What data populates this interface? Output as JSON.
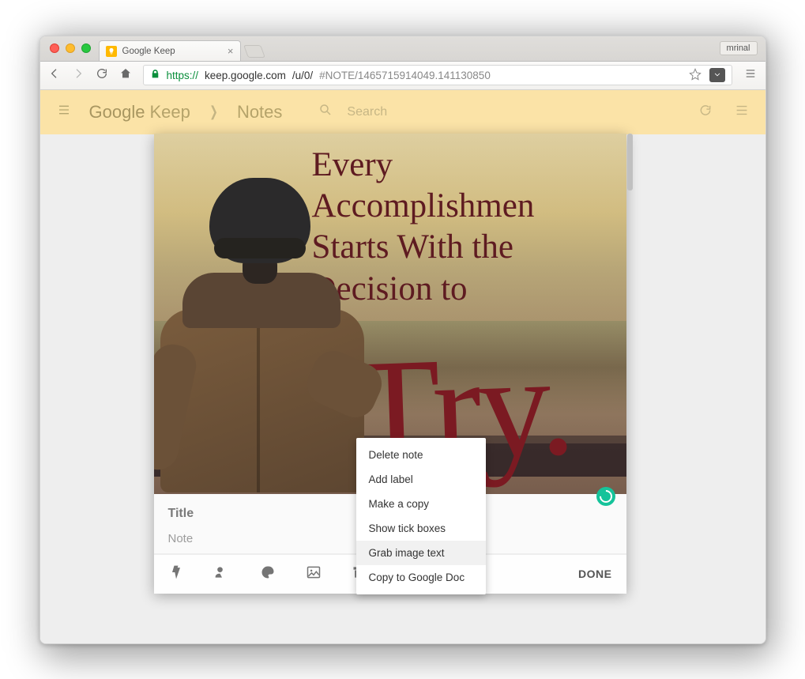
{
  "browser": {
    "tab_title": "Google Keep",
    "profile_name": "mrinal",
    "url_scheme": "https://",
    "url_host": "keep.google.com",
    "url_path": "/u/0/",
    "url_hash": "#NOTE/1465715914049.141130850"
  },
  "keep": {
    "brand_google": "Google",
    "brand_keep": "Keep",
    "breadcrumb": "Notes",
    "search_placeholder": "Search"
  },
  "image_quote": {
    "lines": "Every\nAccomplishmen\nStarts With the\nDecision to",
    "script_word": "Try."
  },
  "note": {
    "title_placeholder": "Title",
    "body_placeholder": "Note",
    "done_label": "DONE"
  },
  "menu": {
    "items": [
      "Delete note",
      "Add label",
      "Make a copy",
      "Show tick boxes",
      "Grab image text",
      "Copy to Google Doc"
    ],
    "highlighted_index": 4
  }
}
